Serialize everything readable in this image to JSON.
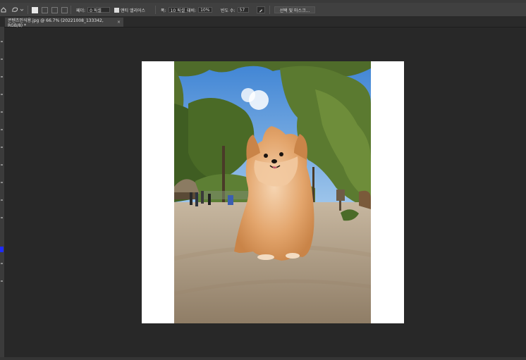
{
  "options_bar": {
    "feather_label": "페더:",
    "feather_value": "0 픽셀",
    "antialias_label": "앤티 앨리어스",
    "width_label": "폭:",
    "width_value": "10 픽셀",
    "contrast_label": "대비:",
    "contrast_value": "10%",
    "frequency_label": "빈도 수:",
    "frequency_value": "57",
    "select_mask_label": "선택 및 마스크..."
  },
  "document_tab": {
    "title": "콘텐츠인식용.jpg @ 66.7% (20221008_133342, RGB/8) *",
    "close": "×"
  },
  "colors": {
    "sky": "#4d8fd6",
    "ground": "#b7a58c",
    "fur": "#e2a770",
    "foreground_swatch": "#1e2bff"
  },
  "icons": [
    "home-icon",
    "magnetic-lasso-icon",
    "new-selection-icon",
    "add-selection-icon",
    "subtract-selection-icon",
    "intersect-selection-icon",
    "pen-pressure-icon"
  ]
}
